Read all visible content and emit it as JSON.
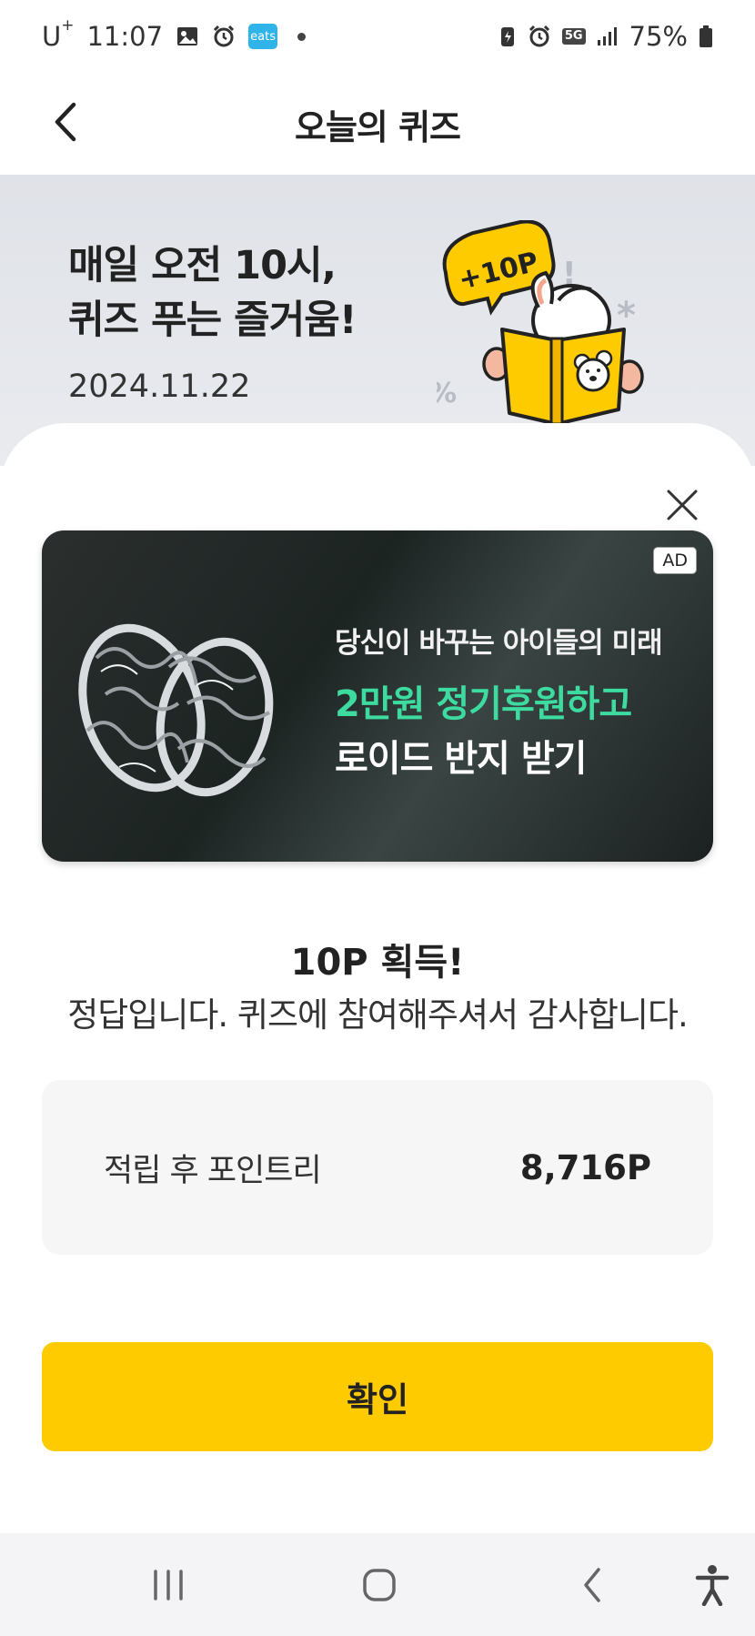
{
  "status_bar": {
    "carrier": "U",
    "carrier_sup": "+",
    "time": "11:07",
    "eats_label": "eats",
    "network": "5G",
    "battery": "75%"
  },
  "header": {
    "title": "오늘의 퀴즈"
  },
  "hero": {
    "title_line1": "매일 오전 10시,",
    "title_line2": "퀴즈 푸는 즐거움!",
    "date": "2024.11.22",
    "bubble_text": "+10P"
  },
  "ad": {
    "badge": "AD",
    "line1": "당신이 바꾸는 아이들의 미래",
    "line2": "2만원 정기후원하고",
    "line3": "로이드 반지 받기"
  },
  "result": {
    "points_earned": "10P 획득!",
    "message": "정답입니다. 퀴즈에 참여해주셔서 감사합니다."
  },
  "balance": {
    "label": "적립 후 포인트리",
    "value": "8,716P"
  },
  "confirm_label": "확인",
  "colors": {
    "accent_yellow": "#fecb00",
    "ad_highlight": "#3ddba0"
  }
}
